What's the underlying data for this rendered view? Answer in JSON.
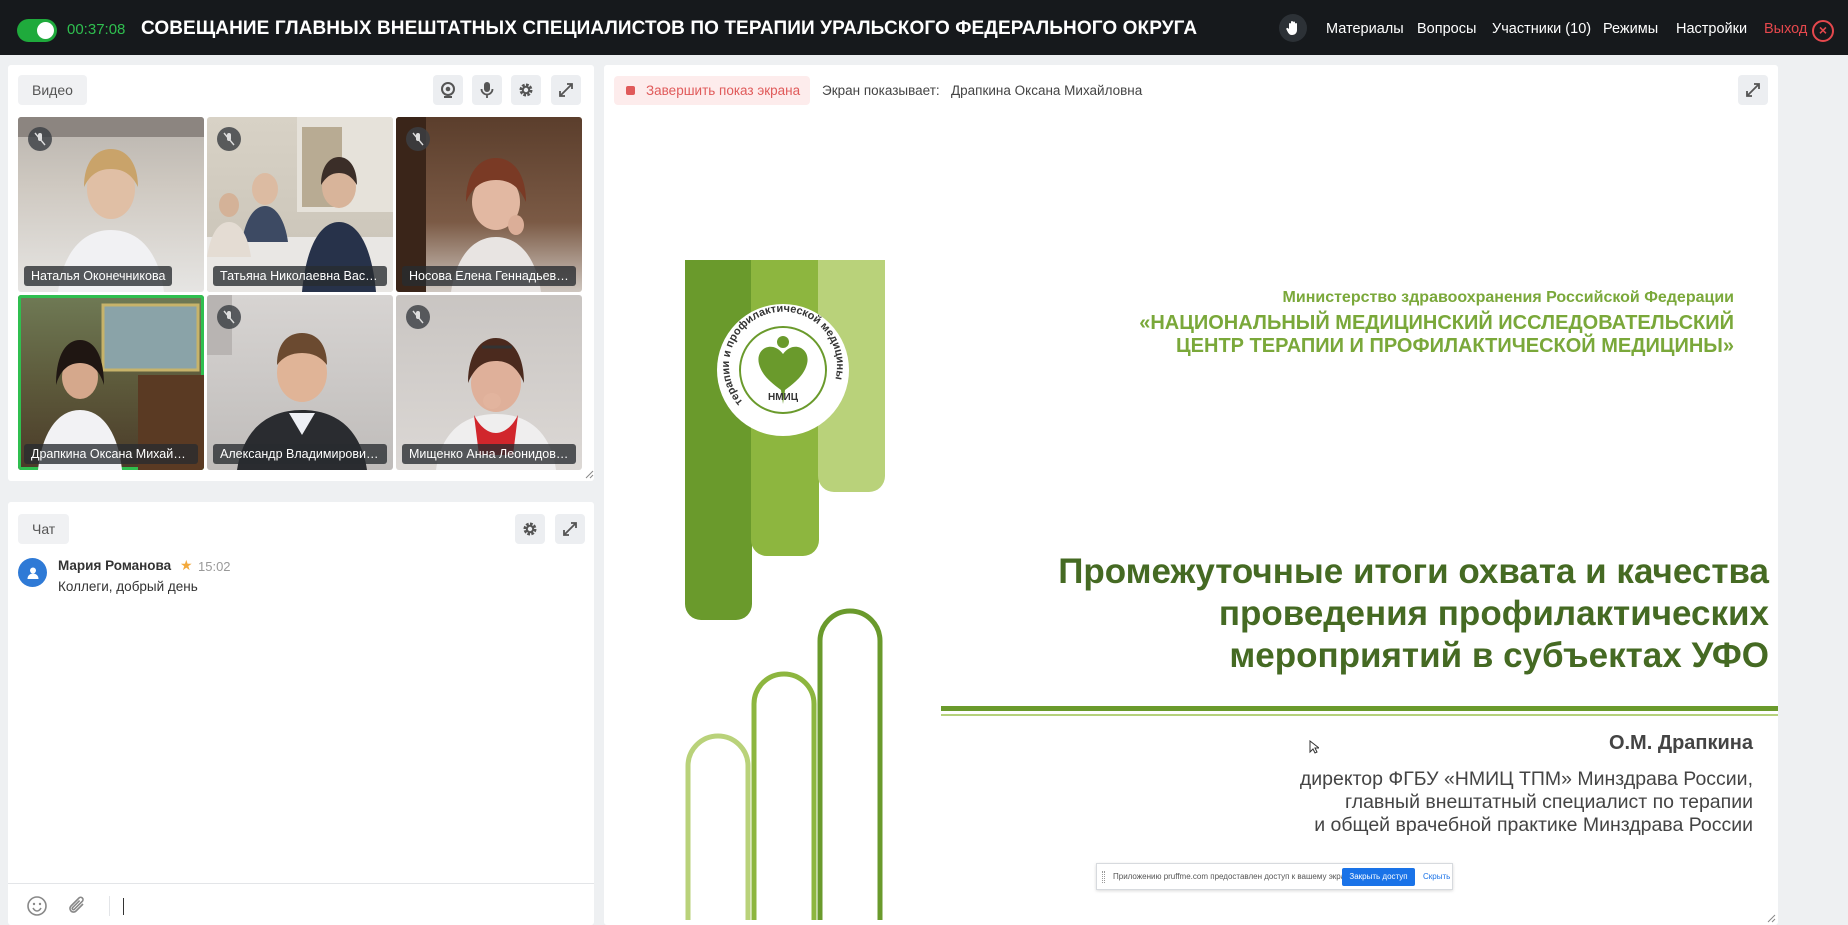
{
  "topbar": {
    "timer": "00:37:08",
    "title": "СОВЕЩАНИЕ ГЛАВНЫХ ВНЕШТАТНЫХ СПЕЦИАЛИСТОВ ПО ТЕРАПИИ УРАЛЬСКОГО ФЕДЕРАЛЬНОГО ОКРУГА",
    "nav": {
      "materials": "Материалы",
      "questions": "Вопросы",
      "participants": "Участники (10)",
      "modes": "Режимы",
      "settings": "Настройки",
      "exit": "Выход"
    },
    "accent": "#1faa3c",
    "exit_color": "#e5484d"
  },
  "video": {
    "label": "Видео",
    "tiles": [
      {
        "name": "Наталья Оконечникова",
        "muted": true,
        "active": false
      },
      {
        "name": "Татьяна Николаевна Васил...",
        "muted": true,
        "active": false
      },
      {
        "name": "Носова Елена Геннадьевна",
        "muted": true,
        "active": false
      },
      {
        "name": "Драпкина Оксана Михайло...",
        "muted": false,
        "active": true
      },
      {
        "name": "Александр Владимирович ...",
        "muted": true,
        "active": false
      },
      {
        "name": "Мищенко Анна Леонидовна",
        "muted": true,
        "active": false
      }
    ]
  },
  "chat": {
    "label": "Чат",
    "messages": [
      {
        "author": "Мария Романова",
        "time": "15:02",
        "text": "Коллеги, добрый день"
      }
    ]
  },
  "screen": {
    "stop_label": "Завершить показ экрана",
    "shows_label": "Экран показывает:",
    "shows_name": "Драпкина Оксана Михайловна"
  },
  "slide": {
    "ministry": "Министерство здравоохранения Российской Федерации",
    "center_line1": "«НАЦИОНАЛЬНЫЙ МЕДИЦИНСКИЙ ИССЛЕДОВАТЕЛЬСКИЙ",
    "center_line2": "ЦЕНТР ТЕРАПИИ И ПРОФИЛАКТИЧЕСКОЙ МЕДИЦИНЫ»",
    "title_line1": "Промежуточные итоги охвата и качества",
    "title_line2": "проведения профилактических",
    "title_line3": "мероприятий в субъектах УФО",
    "author": "О.М. Драпкина",
    "position_line1": "директор ФГБУ «НМИЦ ТПМ» Минздрава России,",
    "position_line2": "главный внештатный специалист по терапии",
    "position_line3": "и общей врачебной практике Минздрава России",
    "logo_ring_text": "терапии и профилактической медицины",
    "logo_abbr": "НМИЦ",
    "green_dark": "#6a9a2c",
    "green_mid": "#8db63f",
    "green_light": "#b9d27a"
  },
  "access_bar": {
    "text": "Приложению pruffme.com предоставлен доступ к вашему экрану.",
    "stop": "Закрыть доступ",
    "hide": "Скрыть"
  }
}
